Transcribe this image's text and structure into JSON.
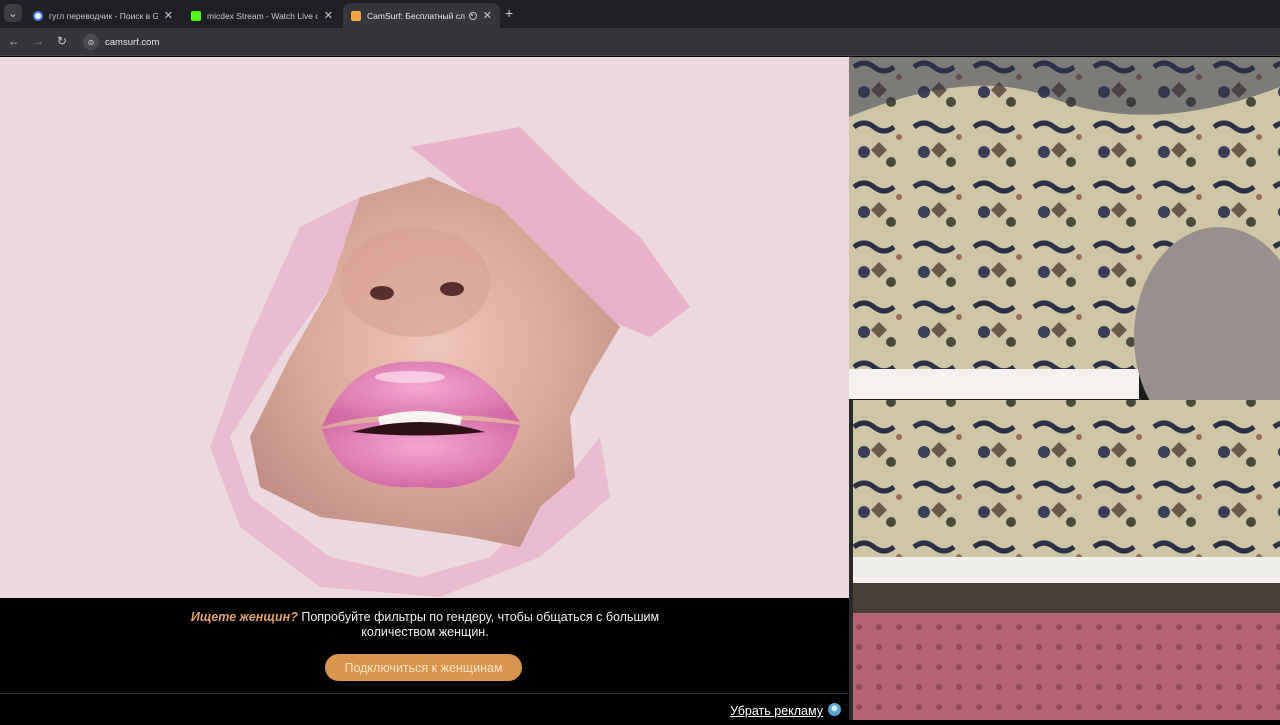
{
  "browser": {
    "tabs": [
      {
        "title": "гугл переводчик - Поиск в Go",
        "favicon_color": "#4285f4",
        "active": false
      },
      {
        "title": "micdex Stream - Watch Live on",
        "favicon_color": "#53fc18",
        "active": false
      },
      {
        "title": "CamSurf: Бесплатный слу",
        "favicon_color": "#f4a142",
        "active": true
      }
    ],
    "url": "camsurf.com",
    "icons": {
      "back": "back-arrow-icon",
      "forward": "forward-arrow-icon",
      "reload": "reload-icon",
      "new_tab": "plus-icon",
      "tab_search": "chevron-down-icon"
    }
  },
  "promo": {
    "accent_text": "Ищете женщин?",
    "body_text": "Попробуйте фильтры по гендеру, чтобы общаться с большим количеством женщин.",
    "cta_label": "Подключиться к женщинам"
  },
  "footer": {
    "remove_ads_label": "Убрать рекламу"
  },
  "colors": {
    "accent": "#e1a164",
    "cta": "#d9954e",
    "hero_bg": "#eed8df"
  }
}
